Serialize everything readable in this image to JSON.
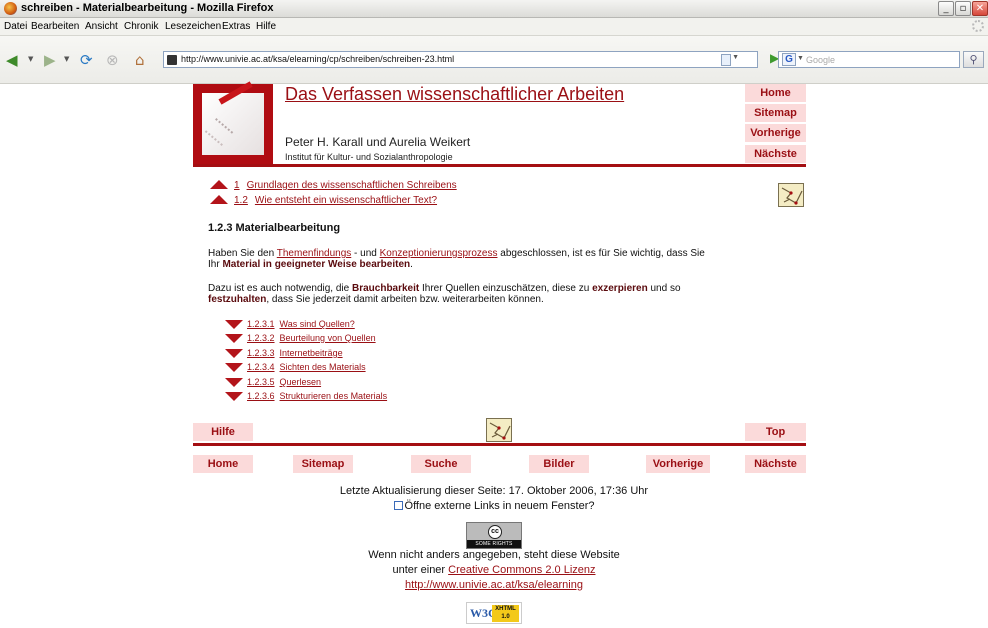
{
  "window": {
    "title": "schreiben - Materialbearbeitung - Mozilla Firefox",
    "min_glyph": "_",
    "max_glyph": "▫",
    "close_glyph": "✕"
  },
  "menu": [
    "Datei",
    "Bearbeiten",
    "Ansicht",
    "Chronik",
    "Lesezeichen",
    "Extras",
    "Hilfe"
  ],
  "toolbar": {
    "url": "http://www.univie.ac.at/ksa/elearning/cp/schreiben/schreiben-23.html",
    "search_placeholder": "Google",
    "search_engine_glyph": "G"
  },
  "header": {
    "site_title": "Das Verfassen wissenschaftlicher Arbeiten",
    "authors": "Peter H. Karall und Aurelia Weikert",
    "institute": "Institut für Kultur- und Sozialanthropologie",
    "nav": [
      "Home",
      "Sitemap",
      "Vorherige",
      "Nächste"
    ]
  },
  "breadcrumb": [
    {
      "num": "1",
      "label": "Grundlagen des wissenschaftlichen Schreibens"
    },
    {
      "num": "1.2",
      "label": "Wie entsteht ein wissenschaftlicher Text?"
    }
  ],
  "section": {
    "title": "1.2.3 Materialbearbeitung",
    "p1": {
      "a": "Haben Sie den ",
      "link1": "Themenfindungs",
      "b": " - und ",
      "link2": "Konzeptionierungsprozess",
      "c": " abgeschlossen, ist es für Sie wichtig, dass Sie",
      "d": "Ihr ",
      "bold": "Material in geeigneter Weise bearbeiten",
      "e": "."
    },
    "p2": {
      "a": "Dazu ist es auch notwendig, die ",
      "bold1": "Brauchbarkeit",
      "b": " Ihrer Quellen einzuschätzen, diese zu ",
      "bold2": "exzerpieren",
      "c": " und so",
      "bold3": "festzuhalten",
      "d": ", dass Sie jederzeit damit arbeiten bzw. weiterarbeiten können."
    },
    "subsections": [
      {
        "num": "1.2.3.1",
        "label": "Was sind Quellen?"
      },
      {
        "num": "1.2.3.2",
        "label": "Beurteilung von Quellen"
      },
      {
        "num": "1.2.3.3",
        "label": "Internetbeiträge"
      },
      {
        "num": "1.2.3.4",
        "label": "Sichten des Materials"
      },
      {
        "num": "1.2.3.5",
        "label": "Querlesen"
      },
      {
        "num": "1.2.3.6",
        "label": "Strukturieren des Materials"
      }
    ]
  },
  "bottom": {
    "help": "Hilfe",
    "top": "Top",
    "nav": [
      "Home",
      "Sitemap",
      "Suche",
      "Bilder",
      "Vorherige",
      "Nächste"
    ]
  },
  "footer": {
    "updated": "Letzte Aktualisierung dieser Seite: 17. Oktober 2006, 17:36 Uhr",
    "external_links": "Öffne externe Links in neuem Fenster?",
    "cc_badge_top": "cc",
    "cc_badge": "SOME RIGHTS RESERVED",
    "license1": "Wenn nicht anders angegeben, steht diese Website",
    "license2_prefix": "unter einer ",
    "license_link": "Creative Commons 2.0 Lizenz",
    "site_url": "http://www.univie.ac.at/ksa/elearning",
    "w3c_text": "W3C",
    "xhtml_label": "XHTML",
    "xhtml_version": "1.0"
  }
}
